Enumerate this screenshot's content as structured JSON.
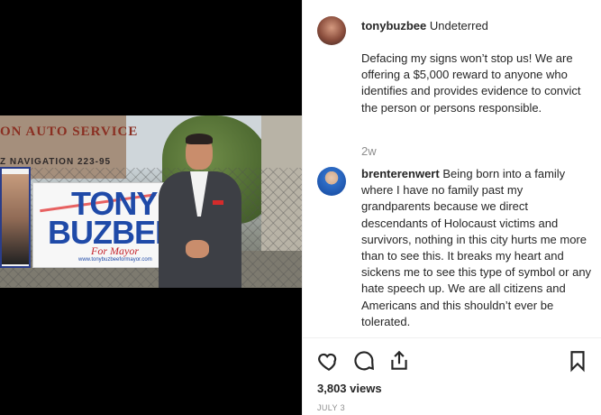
{
  "post": {
    "username": "tonybuzbee",
    "caption_title": "Undeterred",
    "caption_body": "Defacing my signs won’t stop us! We are offering a $5,000 reward to anyone who identifies and provides evidence to convict the person or persons responsible.",
    "time_ago": "2w"
  },
  "comments": [
    {
      "username": "brenterenwert",
      "text": "Being born into a family where I have no family past my grandparents because we direct descendants of Holocaust victims and survivors, nothing in this city hurts me more than to see this. It breaks my heart and sickens me to see this type of symbol or any hate speech up. We are all citizens and Americans and this shouldn’t ever be tolerated."
    }
  ],
  "media": {
    "building_sign": "ON AUTO SERVICE",
    "building_sign_2": "Z NAVIGATION  223-95",
    "sign_line_1": "TONY",
    "sign_line_2": "BUZBEE",
    "sign_line_3": "For Mayor",
    "sign_url": "www.tonybuzbeeformayor.com"
  },
  "actions": {
    "views": "3,803 views",
    "date": "JULY 3"
  },
  "icons": {
    "like": "heart-icon",
    "comment": "comment-bubble-icon",
    "share": "share-icon",
    "save": "bookmark-icon"
  }
}
